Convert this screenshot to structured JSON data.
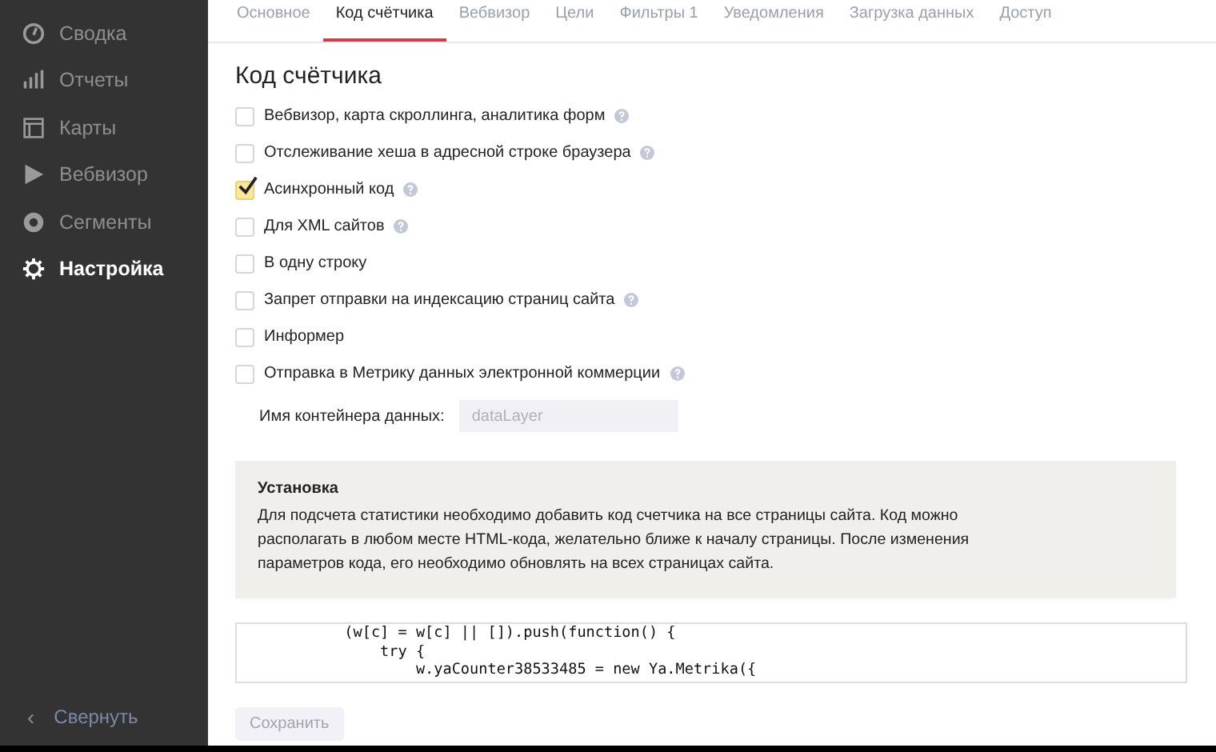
{
  "sidebar": {
    "items": [
      {
        "label": "Сводка",
        "kind": "gauge",
        "selected": false
      },
      {
        "label": "Отчеты",
        "kind": "bars",
        "selected": false
      },
      {
        "label": "Карты",
        "kind": "layout",
        "selected": false
      },
      {
        "label": "Вебвизор",
        "kind": "play",
        "selected": false
      },
      {
        "label": "Сегменты",
        "kind": "ring",
        "selected": false
      },
      {
        "label": "Настройка",
        "kind": "gear",
        "selected": true
      }
    ],
    "collapse": {
      "icon": "‹",
      "label": "Свернуть"
    }
  },
  "tabs": [
    {
      "label": "Основное",
      "selected": false
    },
    {
      "label": "Код счётчика",
      "selected": true
    },
    {
      "label": "Вебвизор",
      "selected": false
    },
    {
      "label": "Цели",
      "selected": false
    },
    {
      "label": "Фильтры 1",
      "selected": false
    },
    {
      "label": "Уведомления",
      "selected": false
    },
    {
      "label": "Загрузка данных",
      "selected": false
    },
    {
      "label": "Доступ",
      "selected": false
    }
  ],
  "heading": "Код счётчика",
  "options": [
    {
      "label": "Вебвизор, карта скроллинга, аналитика форм",
      "checked": false,
      "help": true
    },
    {
      "label": "Отслеживание хеша в адресной строке браузера",
      "checked": false,
      "help": true
    },
    {
      "label": "Асинхронный код",
      "checked": true,
      "help": true
    },
    {
      "label": "Для XML сайтов",
      "checked": false,
      "help": true
    },
    {
      "label": "В одну строку",
      "checked": false,
      "help": false
    },
    {
      "label": "Запрет отправки на индексацию страниц сайта",
      "checked": false,
      "help": true
    },
    {
      "label": "Информер",
      "checked": false,
      "help": false
    },
    {
      "label": "Отправка в Метрику данных электронной коммерции",
      "checked": false,
      "help": true
    }
  ],
  "container_field": {
    "label": "Имя контейнера данных:",
    "placeholder": "dataLayer"
  },
  "install_note": {
    "title": "Установка",
    "text": "Для подсчета статистики необходимо добавить код счетчика на все страницы сайта. Код можно располагать в любом месте HTML-кода, желательно ближе к началу страницы. После изменения параметров кода, его необходимо обновлять на всех страницах сайта."
  },
  "code_lines": [
    "            (w[c] = w[c] || []).push(function() {",
    "                try {",
    "                    w.yaCounter38533485 = new Ya.Metrika({"
  ],
  "save_button": {
    "label": "Сохранить",
    "disabled": true
  }
}
